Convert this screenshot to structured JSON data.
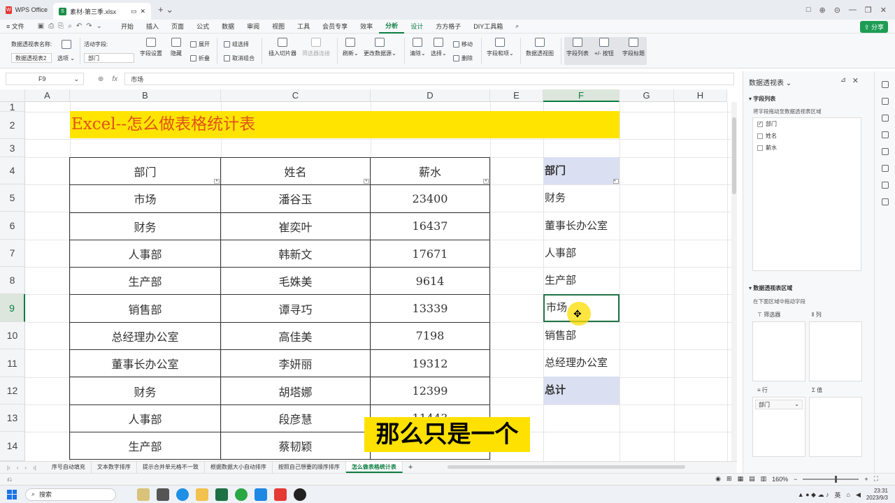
{
  "window": {
    "tabs": [
      {
        "label": "WPS Office"
      },
      {
        "label": "素材-第三季.xlsx"
      }
    ],
    "controls": [
      "□",
      "⊕",
      "⊝",
      "—",
      "❐",
      "✕"
    ]
  },
  "menu": {
    "file": "文件",
    "items": [
      "开始",
      "插入",
      "页面",
      "公式",
      "数据",
      "审阅",
      "视图",
      "工具",
      "会员专享",
      "效率",
      "分析",
      "设计",
      "方方格子",
      "DIY工具箱"
    ],
    "active": "分析",
    "share": "分享"
  },
  "ribbon": {
    "pivot_name_label": "数据透视表名称:",
    "pivot_name_value": "数据透视表2",
    "options": "选项",
    "active_field_label": "活动字段:",
    "active_field_value": "部门",
    "field_settings": "字段设置",
    "hide": "隐藏",
    "expand": "展开",
    "collapse": "折叠",
    "group_selection": "组选择",
    "ungroup": "取消组合",
    "insert_slicer": "插入切片器",
    "filter_connection": "筛选器连接",
    "refresh": "刷新",
    "change_source": "更改数据源",
    "clear": "清除",
    "select": "选择",
    "move": "移动",
    "delete": "删除",
    "fields_items": "字段和项",
    "pivot_chart": "数据透视图",
    "field_list": "字段列表",
    "plus_minus": "+/- 按钮",
    "field_headers": "字段标题"
  },
  "formula_bar": {
    "cell": "F9",
    "value": "市场"
  },
  "columns": [
    "A",
    "B",
    "C",
    "D",
    "E",
    "F",
    "G",
    "H"
  ],
  "rows": [
    "1",
    "2",
    "3",
    "4",
    "5",
    "6",
    "7",
    "8",
    "9",
    "10",
    "11",
    "12",
    "13",
    "14"
  ],
  "title_cell": "Excel--怎么做表格统计表",
  "table": {
    "headers": [
      "部门",
      "姓名",
      "薪水"
    ],
    "rows": [
      [
        "市场",
        "潘谷玉",
        "23400"
      ],
      [
        "财务",
        "崔奕叶",
        "16437"
      ],
      [
        "人事部",
        "韩新文",
        "17671"
      ],
      [
        "生产部",
        "毛姝美",
        "9614"
      ],
      [
        "销售部",
        "谭寻巧",
        "13339"
      ],
      [
        "总经理办公室",
        "高佳美",
        "7198"
      ],
      [
        "董事长办公室",
        "李妍丽",
        "19312"
      ],
      [
        "财务",
        "胡塔娜",
        "12399"
      ],
      [
        "人事部",
        "段彦慧",
        "11443"
      ],
      [
        "生产部",
        "蔡韧颖",
        ""
      ]
    ]
  },
  "pivot": {
    "header": "部门",
    "items": [
      "财务",
      "董事长办公室",
      "人事部",
      "生产部",
      "市场",
      "销售部",
      "总经理办公室"
    ],
    "total": "总计"
  },
  "subtitle": "那么只是一个",
  "sheet_tabs": [
    "序号自动填充",
    "文本数字排序",
    "提示合并单元格不一致",
    "根据数据大小自动排序",
    "按照自己想要的顺序排序",
    "怎么做表格统计表"
  ],
  "active_sheet": "怎么做表格统计表",
  "zoom": "160%",
  "panel": {
    "title": "数据透视表",
    "field_list_title": "字段列表",
    "field_list_hint": "将字段拖动至数据透视表区域",
    "fields": [
      {
        "name": "部门",
        "checked": true
      },
      {
        "name": "姓名",
        "checked": false
      },
      {
        "name": "薪水",
        "checked": false
      }
    ],
    "area_title": "数据透视表区域",
    "area_hint": "在下面区域中拖动字段",
    "filter": "筛选器",
    "columns": "列",
    "rows": "行",
    "values": "值",
    "row_item": "部门"
  },
  "taskbar": {
    "search": "搜索",
    "ime": "英",
    "time": "23:31",
    "date": "2023/9/3"
  }
}
